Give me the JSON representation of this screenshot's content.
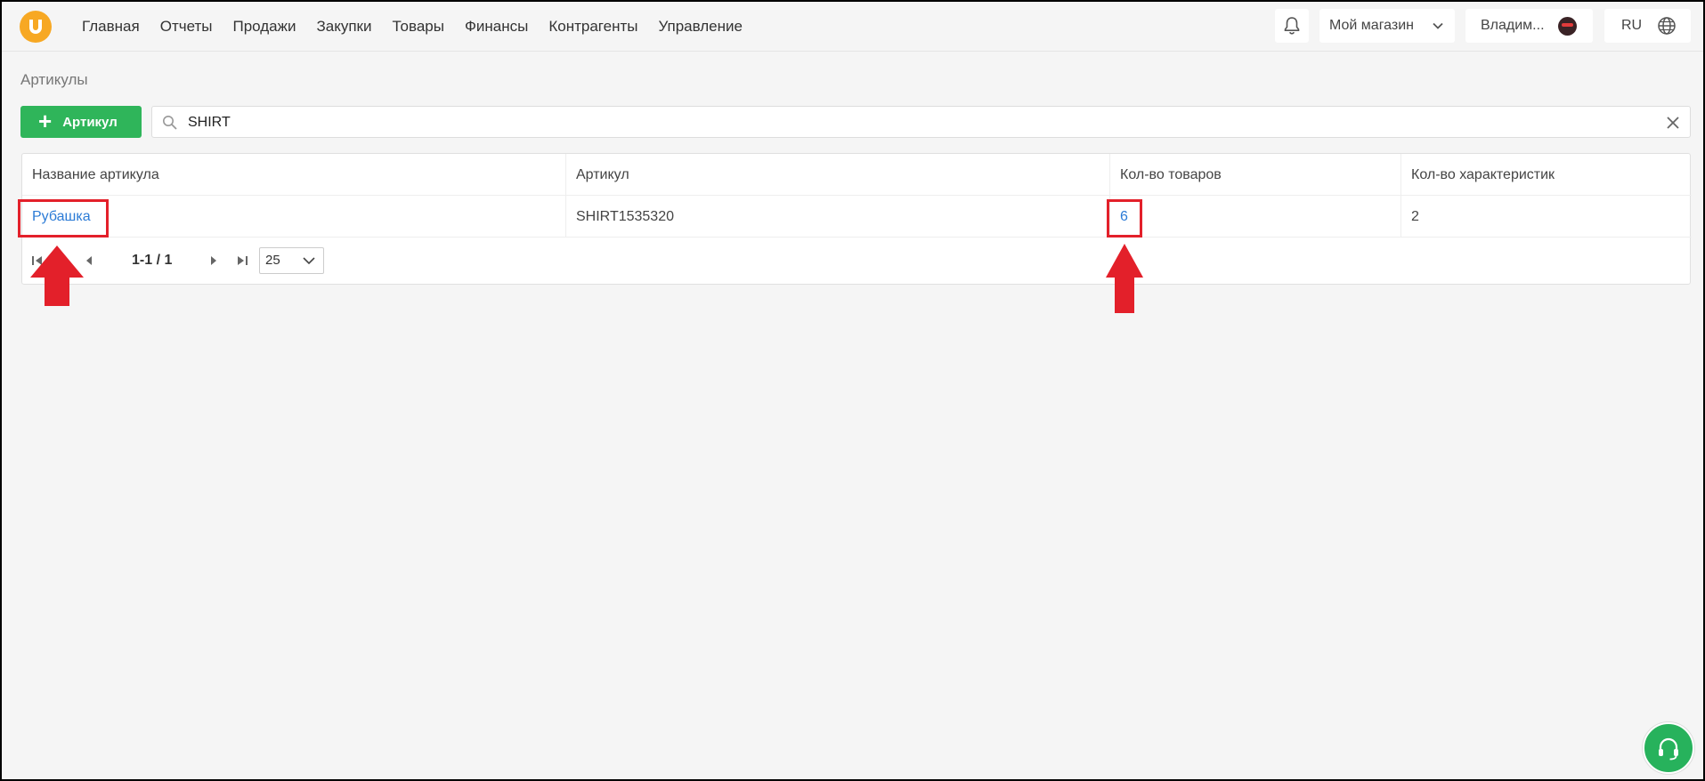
{
  "nav": {
    "items": [
      {
        "label": "Главная"
      },
      {
        "label": "Отчеты"
      },
      {
        "label": "Продажи"
      },
      {
        "label": "Закупки"
      },
      {
        "label": "Товары"
      },
      {
        "label": "Финансы"
      },
      {
        "label": "Контрагенты"
      },
      {
        "label": "Управление"
      }
    ]
  },
  "header": {
    "store_label": "Мой магазин",
    "user_label": "Владим...",
    "lang_label": "RU"
  },
  "page": {
    "title": "Артикулы",
    "add_button": "Артикул",
    "search_value": "SHIRT"
  },
  "table": {
    "columns": [
      "Название артикула",
      "Артикул",
      "Кол-во товаров",
      "Кол-во характеристик"
    ],
    "rows": [
      {
        "name": "Рубашка",
        "sku": "SHIRT1535320",
        "items_count": "6",
        "props_count": "2"
      }
    ]
  },
  "pager": {
    "range": "1-1 / 1",
    "per_page": "25"
  },
  "colors": {
    "accent_green": "#2fb55a",
    "link_blue": "#2b7bd6",
    "logo_orange": "#f7a823",
    "annotation_red": "#e3202a"
  }
}
